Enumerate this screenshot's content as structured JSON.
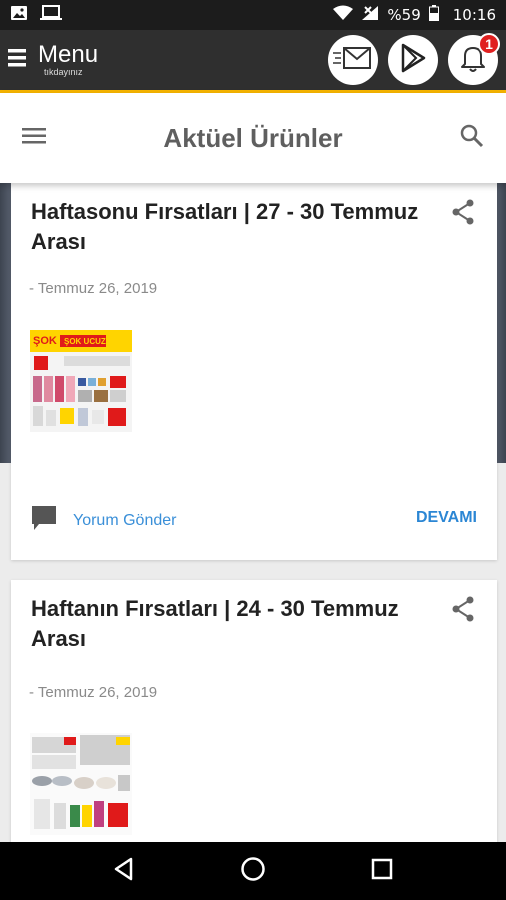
{
  "status_bar": {
    "battery": "%59",
    "time": "10:16",
    "icons": [
      "image-icon",
      "laptop-icon",
      "wifi-icon",
      "signal-icon",
      "battery-icon"
    ]
  },
  "app_bar": {
    "menu_label": "Menu",
    "menu_sub": "tıkdayınız",
    "icons": [
      "mail-icon",
      "play-icon",
      "bell-icon"
    ],
    "notification_count": "1"
  },
  "page_header": {
    "title": "Aktüel Ürünler",
    "icons": [
      "hamburger-icon",
      "search-icon"
    ]
  },
  "posts": [
    {
      "title": "Haftasonu Fırsatları | 27 - 30 Temmuz Arası",
      "date": "- Temmuz 26, 2019",
      "comment_label": "Yorum Gönder",
      "more_label": "DEVAMI"
    },
    {
      "title": "Haftanın Fırsatları | 24 - 30 Temmuz Arası",
      "date": "- Temmuz 26, 2019"
    }
  ],
  "thumb_text": {
    "brand": "ŞOK",
    "banner": "ŞOK UCUZ!"
  },
  "nav_bar": {
    "icons": [
      "back-icon",
      "home-icon",
      "recents-icon"
    ]
  },
  "colors": {
    "accent": "#f5b300",
    "link": "#3a8fd8",
    "badge": "#e02020",
    "app_bar": "#2f2f2f"
  }
}
